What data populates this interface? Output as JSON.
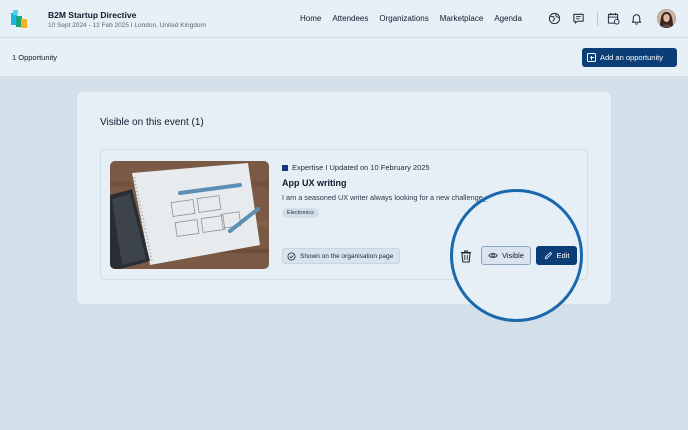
{
  "header": {
    "event_title": "B2M Startup Directive",
    "event_sub": "10 Sept 2024 - 12 Feb 2025 I London, United Kingdom",
    "nav": [
      "Home",
      "Attendees",
      "Organizations",
      "Marketplace",
      "Agenda"
    ],
    "icons": [
      "globe-icon",
      "chat-icon",
      "calendar-icon",
      "bell-icon"
    ]
  },
  "subbar": {
    "count": "1 Opportunity",
    "add_label": "Add an opportunity"
  },
  "panel": {
    "title": "Visible on this event (1)"
  },
  "opportunity": {
    "meta": "Expertise I Updated on 10 February 2025",
    "title": "App UX writing",
    "description": "I am a seasoned UX writer always looking for a new challenge.",
    "tag": "Electronics",
    "shown_label": "Shown on the organisation page",
    "visible_label": "Visible",
    "edit_label": "Edit"
  },
  "colors": {
    "brand": "#0b3d76",
    "highlight_ring": "#1a68ad",
    "background": "#d3e0ea"
  }
}
